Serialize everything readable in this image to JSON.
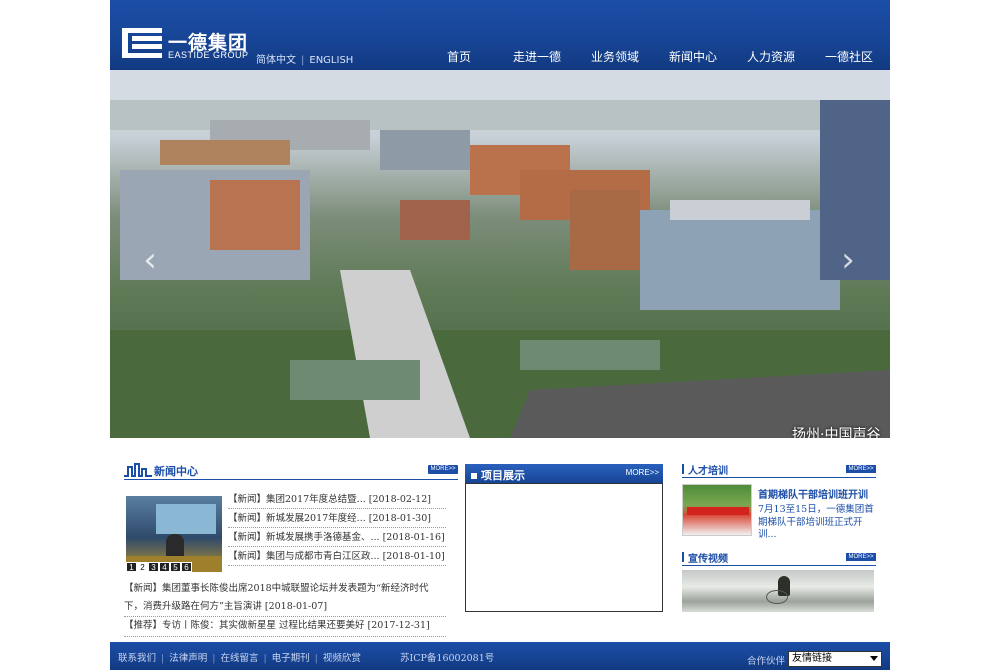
{
  "header": {
    "logo_cn": "一德集团",
    "logo_en": "EASTIDE GROUP",
    "lang_cn": "简体中文",
    "lang_sep": "|",
    "lang_en": "ENGLISH",
    "nav": [
      "首页",
      "走进一德",
      "业务领域",
      "新闻中心",
      "人力资源",
      "一德社区"
    ]
  },
  "banner": {
    "caption": "扬州·中国声谷",
    "arrow_left": "‹",
    "arrow_right": "›"
  },
  "news": {
    "title": "新闻中心",
    "more": "MORE>>",
    "pager": [
      "1",
      "2",
      "3",
      "4",
      "5",
      "6"
    ],
    "pager_active": 1,
    "items": [
      "【新闻】集团2017年度总结暨... [2018-02-12]",
      "【新闻】新城发展2017年度经... [2018-01-30]",
      "【新闻】新城发展携手洛德基金、... [2018-01-16]",
      "【新闻】集团与成都市青白江区政... [2018-01-10]"
    ],
    "wide_items": [
      "【新闻】集团董事长陈俊出席2018中城联盟论坛并发表题为“新经济时代下，消费升级路在何方”主旨演讲 [2018-01-07]",
      "【推荐】专访丨陈俊：其实做新星星 过程比结果还要美好 [2017-12-31]"
    ]
  },
  "projects": {
    "title": "项目展示",
    "more": "MORE>>"
  },
  "talent": {
    "title": "人才培训",
    "more": "MORE>>",
    "headline": "首期梯队干部培训班开训",
    "desc": "7月13至15日，一德集团首期梯队干部培训班正式开训..."
  },
  "video": {
    "title": "宣传视频",
    "more": "MORE>>"
  },
  "footer": {
    "links": [
      "联系我们",
      "法律声明",
      "在线留言",
      "电子期刊",
      "视频欣赏"
    ],
    "icp": "苏ICP备16002081号",
    "partner_label": "合作伙伴",
    "friend_select": "友情链接"
  },
  "colors": {
    "brand_blue": "#1c4ea8",
    "header_dark": "#123a82"
  }
}
